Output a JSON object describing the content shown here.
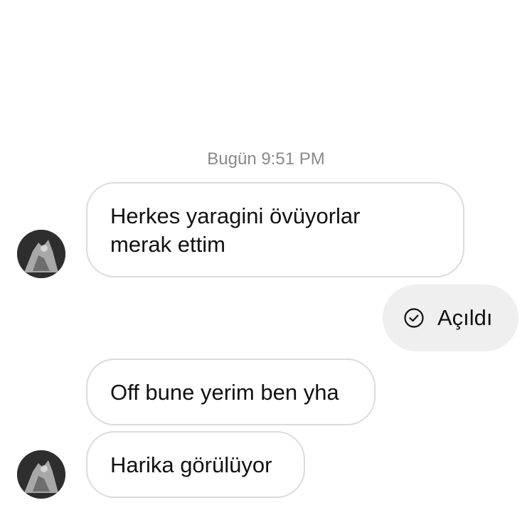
{
  "thread": {
    "timestamp": "Bugün 9:51 PM",
    "messages": [
      {
        "sender": "other",
        "text": "Herkes yaragini övüyorlar\nmerak ettim"
      },
      {
        "sender": "me",
        "type": "media-opened",
        "label": "Açıldı",
        "icon": "check-circle-icon"
      },
      {
        "sender": "other",
        "text": "Off bune yerim ben yha"
      },
      {
        "sender": "other",
        "text": "Harika görülüyor"
      }
    ]
  },
  "colors": {
    "background": "#ffffff",
    "bubble_border": "#dbdbdb",
    "opened_bubble_bg": "#efefef",
    "timestamp_text": "#8a8a8a",
    "message_text": "#111111"
  }
}
